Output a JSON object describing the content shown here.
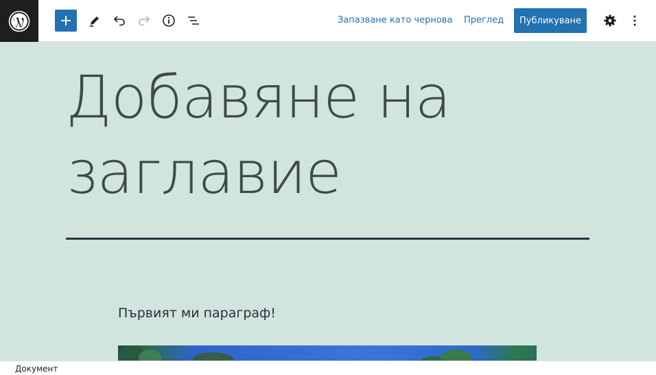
{
  "toolbar": {
    "save_draft_label": "Запазване като чернова",
    "preview_label": "Преглед",
    "publish_label": "Публикуване"
  },
  "post": {
    "title": "Добавяне на заглавие",
    "paragraph": "Първият ми параграф!"
  },
  "footer": {
    "breadcrumb": "Документ"
  },
  "colors": {
    "accent": "#2271b1",
    "canvas_bg": "#d1e4dd",
    "text": "#28303d",
    "logo_bg": "#1e1e1e"
  },
  "icons": {
    "logo": "wordpress-logo-icon",
    "inserter": "plus-icon",
    "tools": "pencil-icon",
    "undo": "undo-icon",
    "redo": "redo-icon",
    "details": "info-icon",
    "outline": "list-view-icon",
    "settings": "gear-icon",
    "options": "more-vertical-icon"
  }
}
